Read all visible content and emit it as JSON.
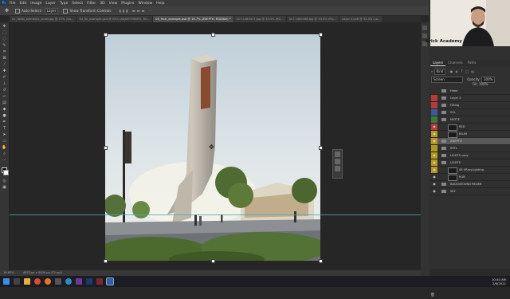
{
  "menu": [
    "File",
    "Edit",
    "Image",
    "Layer",
    "Type",
    "Select",
    "Filter",
    "3D",
    "View",
    "Plugins",
    "Window",
    "Help"
  ],
  "options": {
    "auto_select": "Auto-Select:",
    "auto_select_value": "Layer",
    "transform_controls": "Show Transform Controls"
  },
  "tabs": [
    {
      "label": "01_fields_elements_small.jpg @ 25% (Gu..."
    },
    {
      "label": "04_fill_example.psd @ 25% (ADJUSTMENTS, RG..."
    },
    {
      "label": "05_final_example.psd @ 16.7% (ZDEPTH, RGB/8#) *",
      "active": true
    },
    {
      "label": "SCT-1089417.jpg @ 33.3% (RG..."
    },
    {
      "label": "SCT-1480168.jpg @ 33.3% (RG..."
    },
    {
      "label": "Layer 0.psb @ 33.3% (La..."
    }
  ],
  "status": {
    "zoom": "16.67%",
    "doc": "4875 px x 5000 px (72 ppi)"
  },
  "brand": "Brick Academy",
  "panel_tabs": [
    "Layers",
    "Channels",
    "Paths"
  ],
  "layer_filter": "Kind",
  "blend_mode": "Screen",
  "opacity_label": "Opacity:",
  "opacity": "100%",
  "fill_label": "Fill:",
  "fill": "100%",
  "layers": [
    {
      "name": "Head",
      "color": "none",
      "visible": false
    },
    {
      "name": "Layer 3",
      "color": "red",
      "visible": false
    },
    {
      "name": "Fitting",
      "color": "red",
      "visible": false
    },
    {
      "name": "SVL",
      "color": "blue",
      "visible": false
    },
    {
      "name": "MATTE",
      "color": "green",
      "visible": false
    },
    {
      "name": "RED",
      "color": "red",
      "visible": true,
      "thumb": true
    },
    {
      "name": "BLUM",
      "color": "yellow",
      "visible": true,
      "thumb": true
    },
    {
      "name": "ZDEPTH",
      "color": "yellow",
      "visible": true,
      "selected": true
    },
    {
      "name": "REFL",
      "color": "yellow",
      "visible": false
    },
    {
      "name": "LIGHTS copy",
      "color": "yellow",
      "visible": true
    },
    {
      "name": "LIGHTS",
      "color": "yellow",
      "visible": true
    },
    {
      "name": "08 VRaryLighting",
      "color": "yellow",
      "visible": true,
      "thumb": true
    },
    {
      "name": "RGB",
      "color": "none",
      "visible": true,
      "thumb": true
    },
    {
      "name": "BACKGROUND REDER",
      "color": "none",
      "visible": true
    },
    {
      "name": "SKY",
      "color": "none",
      "visible": true
    }
  ],
  "clock": {
    "time": "10:40 AM",
    "date": "2/6/2021"
  },
  "colors": {
    "red": "#b53a3a",
    "yellow": "#b39520",
    "green": "#3f7a3a",
    "blue": "#3a5a9a",
    "selected": "#5a5a5a"
  }
}
